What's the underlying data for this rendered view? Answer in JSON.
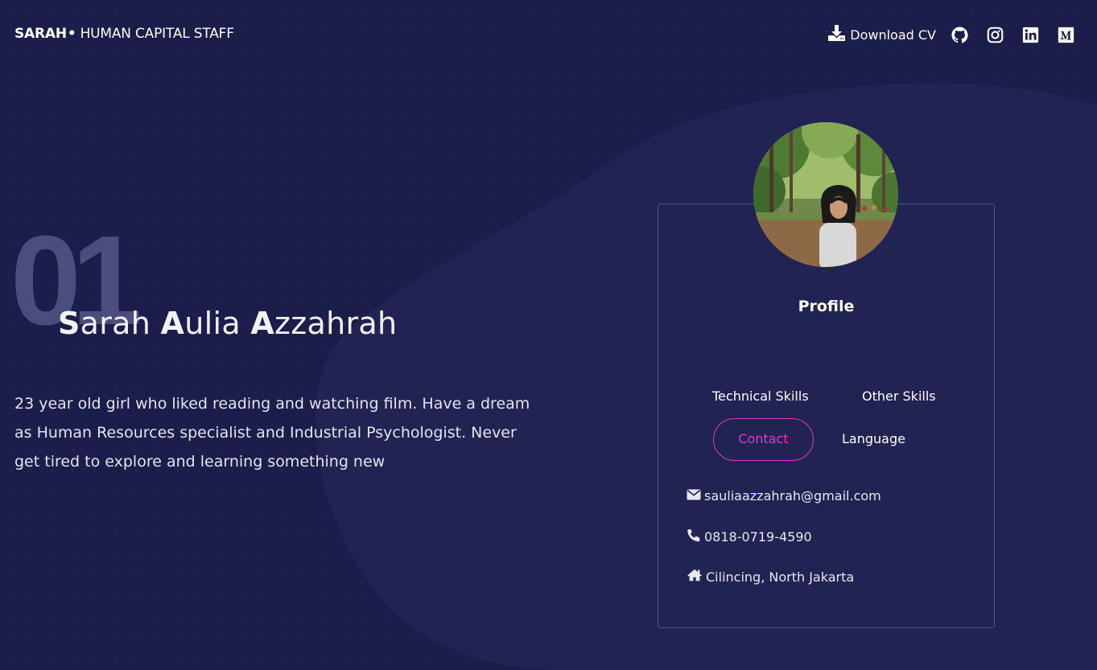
{
  "nav": {
    "brand_name": "SARAH",
    "brand_dot": "•",
    "brand_role": "HUMAN CAPITAL STAFF",
    "download_label": "Download CV",
    "icons": [
      "download-icon",
      "github-icon",
      "instagram-icon",
      "linkedin-icon",
      "medium-icon"
    ]
  },
  "hero": {
    "number": "01",
    "name_parts": [
      {
        "cap": "S",
        "rest": "arah "
      },
      {
        "cap": "A",
        "rest": "ulia "
      },
      {
        "cap": "A",
        "rest": "zzahrah"
      }
    ],
    "description": "23 year old girl who liked reading and watching film. Have a dream as Human Resources specialist and Industrial Psychologist. Never get tired to explore and learning something new"
  },
  "profile": {
    "title": "Profile",
    "tabs": {
      "technical": "Technical Skills",
      "other": "Other Skills",
      "contact": "Contact",
      "language": "Language"
    },
    "active_tab": "Contact",
    "contact": {
      "email": "sauliaazzahrah@gmail.com",
      "phone": "0818-0719-4590",
      "address": "Cilincing, North Jakarta"
    }
  },
  "colors": {
    "background": "#1b1d4b",
    "blob": "#212452",
    "accent": "#d63fc3",
    "card_border": "#4a5591"
  }
}
